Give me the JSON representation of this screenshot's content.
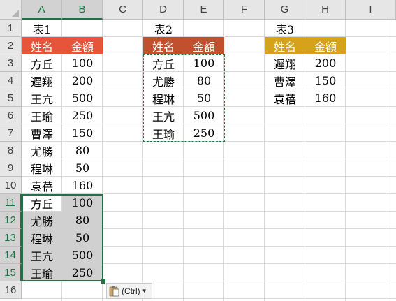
{
  "columns": [
    "A",
    "B",
    "C",
    "D",
    "E",
    "F",
    "G",
    "H",
    "I"
  ],
  "rows": [
    "1",
    "2",
    "3",
    "4",
    "5",
    "6",
    "7",
    "8",
    "9",
    "10",
    "11",
    "12",
    "13",
    "14",
    "15",
    "16"
  ],
  "colors": {
    "table1_header": "#e6553a",
    "table2_header": "#c0502e",
    "table3_header": "#d7a21b",
    "selection": "#217346"
  },
  "table1": {
    "title": "表1",
    "headers": [
      "姓名",
      "金額"
    ],
    "rows": [
      [
        "方丘",
        "100"
      ],
      [
        "遲翔",
        "200"
      ],
      [
        "王亢",
        "500"
      ],
      [
        "王瑜",
        "250"
      ],
      [
        "曹澤",
        "150"
      ],
      [
        "尤勝",
        "80"
      ],
      [
        "程琳",
        "50"
      ],
      [
        "袁蓓",
        "160"
      ]
    ],
    "pasted": [
      [
        "方丘",
        "100"
      ],
      [
        "尤勝",
        "80"
      ],
      [
        "程琳",
        "50"
      ],
      [
        "王亢",
        "500"
      ],
      [
        "王瑜",
        "250"
      ]
    ]
  },
  "table2": {
    "title": "表2",
    "headers": [
      "姓名",
      "金額"
    ],
    "rows": [
      [
        "方丘",
        "100"
      ],
      [
        "尤勝",
        "80"
      ],
      [
        "程琳",
        "50"
      ],
      [
        "王亢",
        "500"
      ],
      [
        "王瑜",
        "250"
      ]
    ]
  },
  "table3": {
    "title": "表3",
    "headers": [
      "姓名",
      "金額"
    ],
    "rows": [
      [
        "遲翔",
        "200"
      ],
      [
        "曹澤",
        "150"
      ],
      [
        "袁蓓",
        "160"
      ]
    ]
  },
  "paste_options": {
    "label": "(Ctrl)",
    "icon": "clipboard-icon"
  }
}
